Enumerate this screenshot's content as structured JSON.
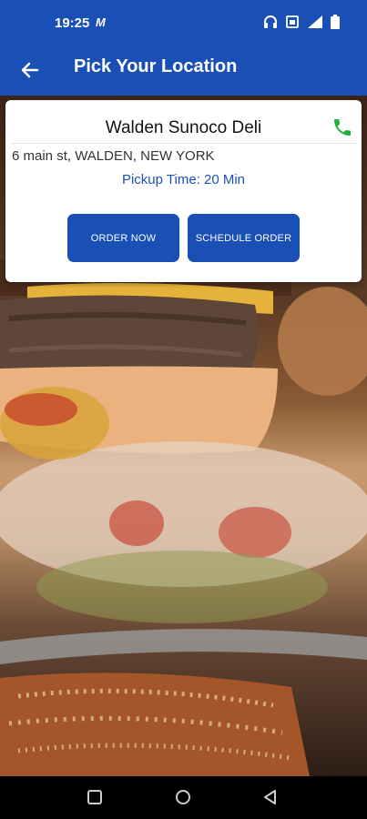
{
  "status_bar": {
    "time": "19:25",
    "app_icon_text": "M",
    "icons": [
      "headphones-icon",
      "sim-icon",
      "signal-icon",
      "battery-icon"
    ]
  },
  "app_bar": {
    "title": "Pick Your Location",
    "back_icon": "arrow-left-icon"
  },
  "location": {
    "name": "Walden Sunoco Deli",
    "address": "6 main st, WALDEN, NEW YORK",
    "pickup_time": "Pickup Time: 20 Min",
    "phone_icon": "phone-icon"
  },
  "actions": {
    "order_now": "ORDER NOW",
    "schedule_order": "SCHEDULE ORDER"
  },
  "nav_bar": {
    "icons": [
      "square-icon",
      "circle-icon",
      "triangle-back-icon"
    ]
  },
  "colors": {
    "brand_blue": "#1a4fb5",
    "phone_green": "#1db13a"
  }
}
